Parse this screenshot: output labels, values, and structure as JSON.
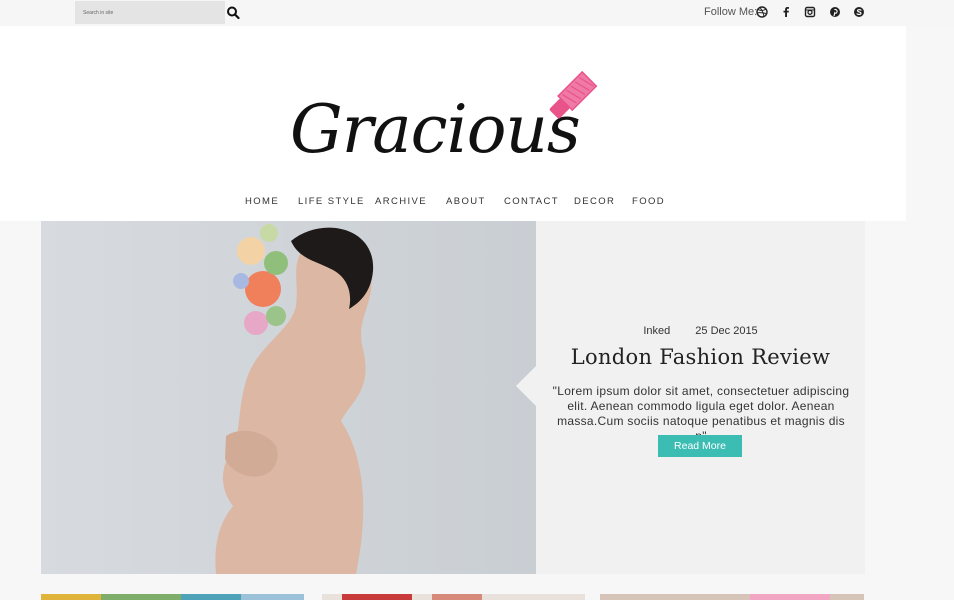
{
  "topbar": {
    "search_placeholder": "Search in site",
    "follow_label": "Follow Me:",
    "social_icons": [
      "dribbble-icon",
      "facebook-icon",
      "instagram-icon",
      "pinterest-icon",
      "skype-icon"
    ]
  },
  "header": {
    "logo_text": "Gracious",
    "logo_accent_color": "#e8538a"
  },
  "nav": {
    "items": [
      "HOME",
      "LIFE STYLE",
      "ARCHIVE",
      "ABOUT",
      "CONTACT",
      "DECOR",
      "FOOD"
    ]
  },
  "featured": {
    "category": "Inked",
    "date": "25 Dec 2015",
    "title": "London Fashion Review",
    "excerpt": "\"Lorem ipsum dolor sit amet, consectetuer adipiscing elit. Aenean commodo ligula eget dolor. Aenean massa.Cum sociis natoque penatibus et magnis dis p\"",
    "read_more": "Read More",
    "button_color": "#3cbdb4"
  }
}
